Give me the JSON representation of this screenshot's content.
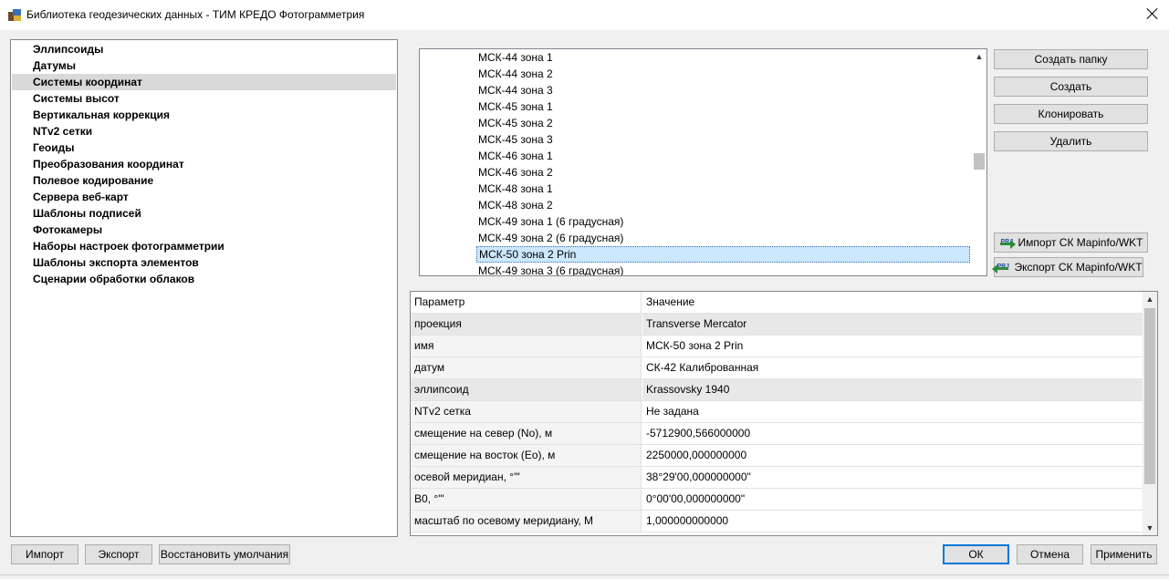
{
  "window": {
    "title": "Библиотека геодезических данных - ТИМ КРЕДО Фотограмметрия"
  },
  "tree": {
    "items": [
      {
        "label": "Эллипсоиды"
      },
      {
        "label": "Датумы"
      },
      {
        "label": "Системы координат",
        "selected": true
      },
      {
        "label": "Системы высот"
      },
      {
        "label": "Вертикальная коррекция"
      },
      {
        "label": "NTv2 сетки"
      },
      {
        "label": "Геоиды"
      },
      {
        "label": "Преобразования координат"
      },
      {
        "label": "Полевое кодирование"
      },
      {
        "label": "Сервера веб-карт"
      },
      {
        "label": "Шаблоны подписей"
      },
      {
        "label": "Фотокамеры"
      },
      {
        "label": "Наборы настроек фотограмметрии"
      },
      {
        "label": "Шаблоны экспорта элементов"
      },
      {
        "label": "Сценарии обработки облаков"
      }
    ]
  },
  "list": {
    "items": [
      {
        "label": "МСК-44 зона 1"
      },
      {
        "label": "МСК-44 зона 2"
      },
      {
        "label": "МСК-44 зона 3"
      },
      {
        "label": "МСК-45 зона 1"
      },
      {
        "label": "МСК-45 зона 2"
      },
      {
        "label": "МСК-45 зона 3"
      },
      {
        "label": "МСК-46 зона 1"
      },
      {
        "label": "МСК-46 зона 2"
      },
      {
        "label": "МСК-48 зона 1"
      },
      {
        "label": "МСК-48 зона 2"
      },
      {
        "label": "МСК-49 зона 1 (6 градусная)"
      },
      {
        "label": "МСК-49 зона 2 (6 градусная)"
      },
      {
        "label": "МСК-50 зона 2 Prin",
        "selected": true
      },
      {
        "label": "МСК-49 зона 3 (6 градусная)"
      }
    ]
  },
  "side_buttons": {
    "create_folder": "Создать папку",
    "create": "Создать",
    "clone": "Клонировать",
    "delete": "Удалить",
    "import_prj": "Импорт СК Mapinfo/WKT",
    "export_prj": "Экспорт СК Mapinfo/WKT",
    "prj_badge": "PRJ"
  },
  "properties": {
    "headers": {
      "param": "Параметр",
      "value": "Значение"
    },
    "rows": [
      {
        "param": "проекция",
        "value": "Transverse Mercator"
      },
      {
        "param": "имя",
        "value": "МСК-50 зона 2 Prin"
      },
      {
        "param": "датум",
        "value": "СК-42 Калиброванная"
      },
      {
        "param": "эллипсоид",
        "value": "Krassovsky 1940"
      },
      {
        "param": "NTv2 сетка",
        "value": "Не задана"
      },
      {
        "param": "смещение на север (No), м",
        "value": "-5712900,566000000"
      },
      {
        "param": "смещение на восток (Eo), м",
        "value": "2250000,000000000"
      },
      {
        "param": "осевой меридиан, °'\"",
        "value": " 38°29'00,000000000\""
      },
      {
        "param": "B0, °'\"",
        "value": " 0°00'00,000000000\""
      },
      {
        "param": "масштаб по осевому меридиану, М",
        "value": "1,000000000000"
      }
    ]
  },
  "footer": {
    "import": "Импорт",
    "export": "Экспорт",
    "restore_defaults": "Восстановить умолчания",
    "ok": "ОК",
    "cancel": "Отмена",
    "apply": "Применить"
  }
}
